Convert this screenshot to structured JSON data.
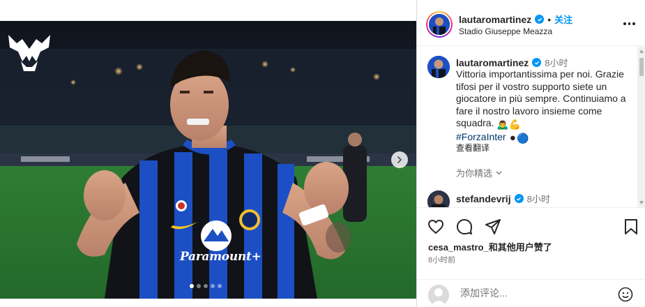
{
  "post": {
    "slide_count": 5,
    "active_slide": 1,
    "sponsor_text": "Paramount+"
  },
  "header": {
    "username": "lautaromartinez",
    "separator": "•",
    "follow_label": "关注",
    "location": "Stadio Giuseppe Meazza"
  },
  "caption": {
    "username": "lautaromartinez",
    "time": "8小时",
    "text": "Vittoria importantissima per noi. Grazie tifosi per il vostro supporto siete un giocatore in più sempre. Continuiamo a fare il nostro lavoro insieme come squadra.",
    "emojis": "🙇‍♂️💪",
    "hashtag": "#ForzaInter",
    "hashtag_emojis": "⚫🔵",
    "translate_label": "查看翻译"
  },
  "for_you_label": "为你精选",
  "comment2": {
    "username": "stefandevrij",
    "time": "8小时"
  },
  "actions": {
    "liked_by_user": "cesa_mastro_",
    "liked_by_suffix": "和其他用户赞了",
    "post_time": "8小时前"
  },
  "comment_input": {
    "placeholder": "添加评论..."
  },
  "colors": {
    "accent": "#0095f6",
    "hashtag": "#00376b",
    "muted": "#737373",
    "inter_blue": "#1c4fc4"
  }
}
